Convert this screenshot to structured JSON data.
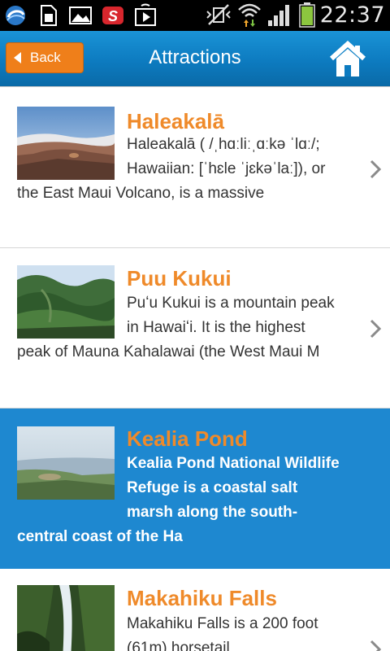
{
  "status_bar": {
    "time": "22:37",
    "icons": [
      "app-logo-icon",
      "sim-card-icon",
      "gallery-icon",
      "app-s-icon",
      "play-store-icon",
      "vibrate-mute-icon",
      "wifi-icon",
      "signal-icon",
      "battery-icon"
    ]
  },
  "header": {
    "back_label": "Back",
    "title": "Attractions",
    "home_icon": "home-icon"
  },
  "attractions": [
    {
      "title": "Haleakalā",
      "description": "Haleakalā ( /ˌhɑːliːˌɑːkə ˈlɑː/; Hawaiian: [ˈhɛle ˈjɛkəˈlaː]), or the East Maui Volcano, is a massive"
    },
    {
      "title": "Puu Kukui",
      "description": "Puʻu Kukui is a mountain peak in Hawaiʻi. It is the highest peak of Mauna Kahalawai (the West Maui M"
    },
    {
      "title": "Kealia Pond",
      "description": "Kealia Pond National Wildlife Refuge is a coastal salt marsh along the south-central coast of the Ha",
      "selected": true
    },
    {
      "title": "Makahiku Falls",
      "description": "Makahiku Falls is a 200 foot (61m) horsetail"
    }
  ],
  "colors": {
    "header_blue": "#0d7bc0",
    "back_orange": "#ef7f1a",
    "title_orange": "#ef8a2a",
    "selected_blue": "#1e88d0"
  }
}
